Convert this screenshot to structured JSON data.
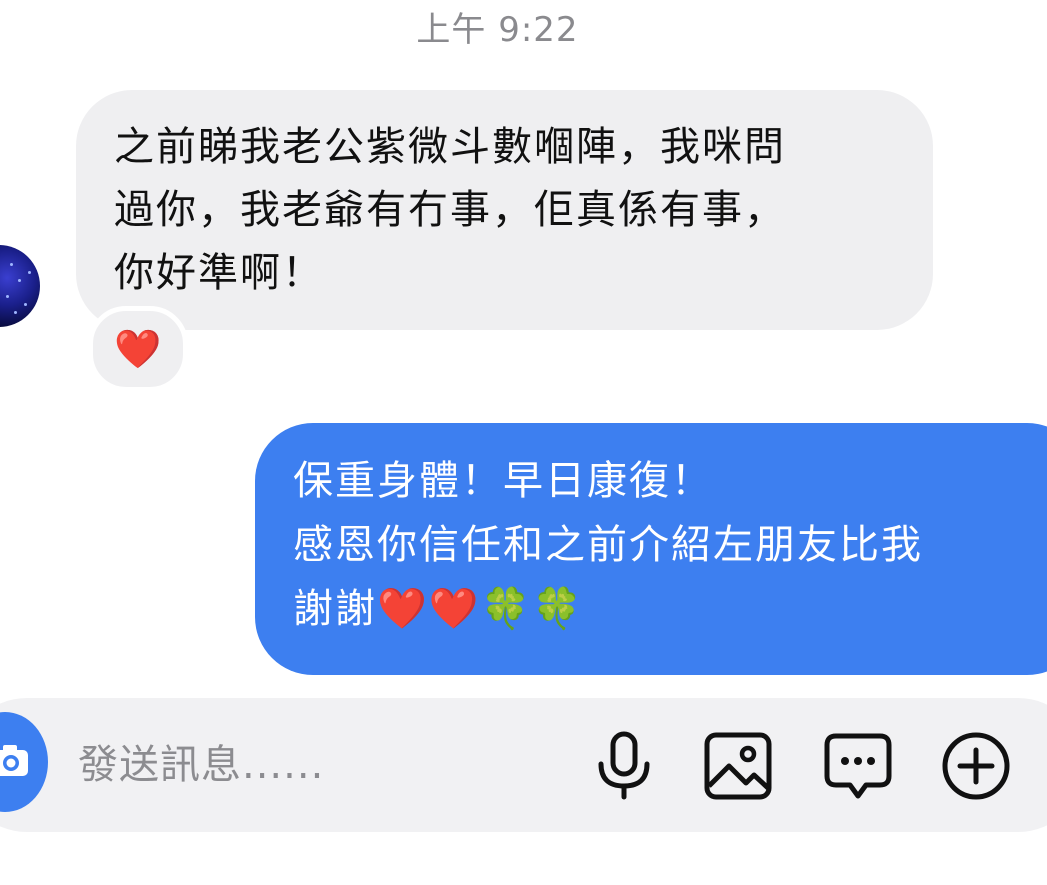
{
  "chat": {
    "timestamp": "上午 9:22",
    "incoming_message": {
      "lines": [
        "之前睇我老公紫微斗數嗰陣，我咪問",
        "過你，我老爺有冇事，佢真係有事，",
        "你好準啊！"
      ],
      "reaction": "❤️"
    },
    "outgoing_message": {
      "lines": [
        "保重身體！早日康復！",
        "感恩你信任和之前介紹左朋友比我",
        "謝謝❤️❤️🍀🍀"
      ]
    }
  },
  "composer": {
    "placeholder": "發送訊息......",
    "icons": [
      "camera-icon",
      "microphone-icon",
      "image-icon",
      "sticker-message-icon",
      "add-icon"
    ]
  },
  "colors": {
    "outgoing_bubble": "#3d7ff0",
    "incoming_bubble": "#efeff1",
    "composer_bg": "#f1f1f3"
  }
}
